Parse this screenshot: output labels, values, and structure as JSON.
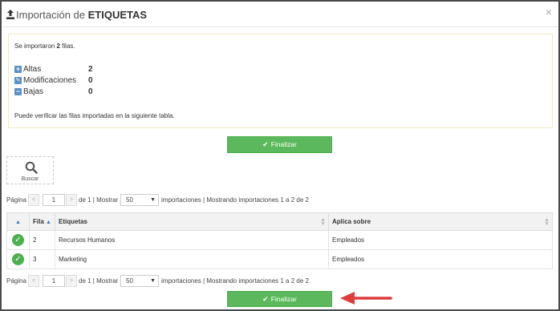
{
  "header": {
    "title_prefix": "Importación de",
    "title_bold": "ETIQUETAS",
    "close_glyph": "×"
  },
  "summary": {
    "line1_prefix": "Se importaron",
    "line1_count": "2",
    "line1_suffix": "filas.",
    "stats": [
      {
        "icon": "plus-square-icon",
        "glyph": "+",
        "label": "Altas",
        "value": "2"
      },
      {
        "icon": "edit-square-icon",
        "glyph": "✎",
        "label": "Modificaciones",
        "value": "0"
      },
      {
        "icon": "minus-square-icon",
        "glyph": "−",
        "label": "Bajas",
        "value": "0"
      }
    ],
    "line2": "Puede verificar las filas importadas en la siguiente tabla."
  },
  "finalizar_label": "Finalizar",
  "buscar_label": "Buscar",
  "pager": {
    "page_label": "Página",
    "prev": "<",
    "next": ">",
    "page_value": "1",
    "of_text": "de 1 | Mostrar",
    "page_size": "50",
    "info": "importaciones | Mostrando importaciones 1 a 2 de 2"
  },
  "table": {
    "headers": {
      "fila": "Fila",
      "etiquetas": "Etiquetas",
      "aplica": "Aplica sobre"
    },
    "rows": [
      {
        "fila": "2",
        "etiqueta": "Recursos Humanos",
        "aplica": "Empleados"
      },
      {
        "fila": "3",
        "etiqueta": "Marketing",
        "aplica": "Empleados"
      }
    ]
  },
  "colors": {
    "accent_green": "#5cb85c",
    "status_green": "#4cb04f",
    "arrow_red": "#e03c3c",
    "icon_blue": "#5b8fc7"
  }
}
